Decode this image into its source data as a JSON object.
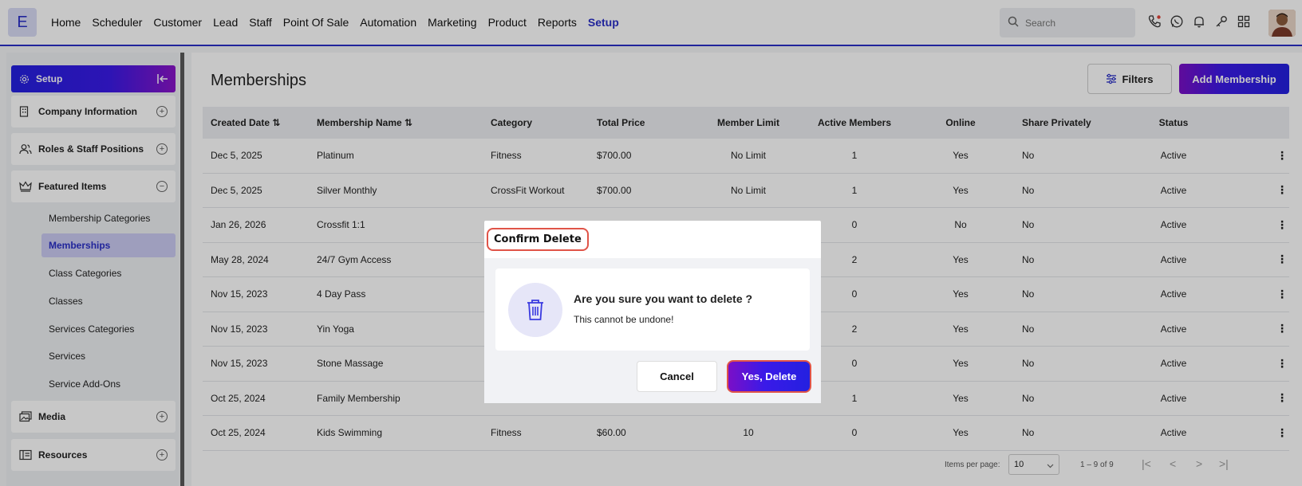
{
  "app": {
    "logo_letter": "E",
    "accent_color": "#2a2fc7"
  },
  "nav": {
    "items": [
      "Home",
      "Scheduler",
      "Customer",
      "Lead",
      "Staff",
      "Point Of Sale",
      "Automation",
      "Marketing",
      "Product",
      "Reports",
      "Setup"
    ],
    "active": "Setup",
    "search_placeholder": "Search",
    "icons": [
      "phone-icon",
      "whatsapp-icon",
      "bell-icon",
      "key-icon",
      "apps-grid-icon"
    ]
  },
  "sidebar": {
    "header": "Setup",
    "sections": {
      "company": "Company Information",
      "roles": "Roles & Staff Positions",
      "featured": "Featured Items",
      "media": "Media",
      "resources": "Resources"
    },
    "sub_items": [
      "Membership Categories",
      "Memberships",
      "Class Categories",
      "Classes",
      "Services Categories",
      "Services",
      "Service Add-Ons"
    ],
    "active_sub": "Memberships"
  },
  "main": {
    "title": "Memberships",
    "filters_label": "Filters",
    "add_label": "Add Membership",
    "columns": [
      "Created Date",
      "Membership Name",
      "Category",
      "Total Price",
      "Member Limit",
      "Active Members",
      "Online",
      "Share Privately",
      "Status"
    ],
    "rows": [
      [
        "Dec 5, 2025",
        "Platinum",
        "Fitness",
        "$700.00",
        "No Limit",
        "1",
        "Yes",
        "No",
        "Active"
      ],
      [
        "Dec 5, 2025",
        "Silver Monthly",
        "CrossFit Workout",
        "$700.00",
        "No Limit",
        "1",
        "Yes",
        "No",
        "Active"
      ],
      [
        "Jan 26, 2026",
        "Crossfit 1:1",
        "",
        "",
        "",
        "0",
        "No",
        "No",
        "Active"
      ],
      [
        "May 28, 2024",
        "24/7 Gym Access",
        "",
        "",
        "",
        "2",
        "Yes",
        "No",
        "Active"
      ],
      [
        "Nov 15, 2023",
        "4 Day Pass",
        "",
        "",
        "",
        "0",
        "Yes",
        "No",
        "Active"
      ],
      [
        "Nov 15, 2023",
        "Yin Yoga",
        "",
        "",
        "",
        "2",
        "Yes",
        "No",
        "Active"
      ],
      [
        "Nov 15, 2023",
        "Stone Massage",
        "",
        "",
        "",
        "0",
        "Yes",
        "No",
        "Active"
      ],
      [
        "Oct 25, 2024",
        "Family Membership",
        "",
        "",
        "",
        "1",
        "Yes",
        "No",
        "Active"
      ],
      [
        "Oct 25, 2024",
        "Kids Swimming",
        "Fitness",
        "$60.00",
        "10",
        "0",
        "Yes",
        "No",
        "Active"
      ]
    ],
    "pager": {
      "items_per_page_label": "Items per page:",
      "items_per_page": "10",
      "range": "1 – 9 of 9"
    }
  },
  "modal": {
    "title": "Confirm Delete",
    "message": "Are you sure you want to delete ?",
    "sub": "This cannot be undone!",
    "cancel_label": "Cancel",
    "confirm_label": "Yes, Delete"
  }
}
